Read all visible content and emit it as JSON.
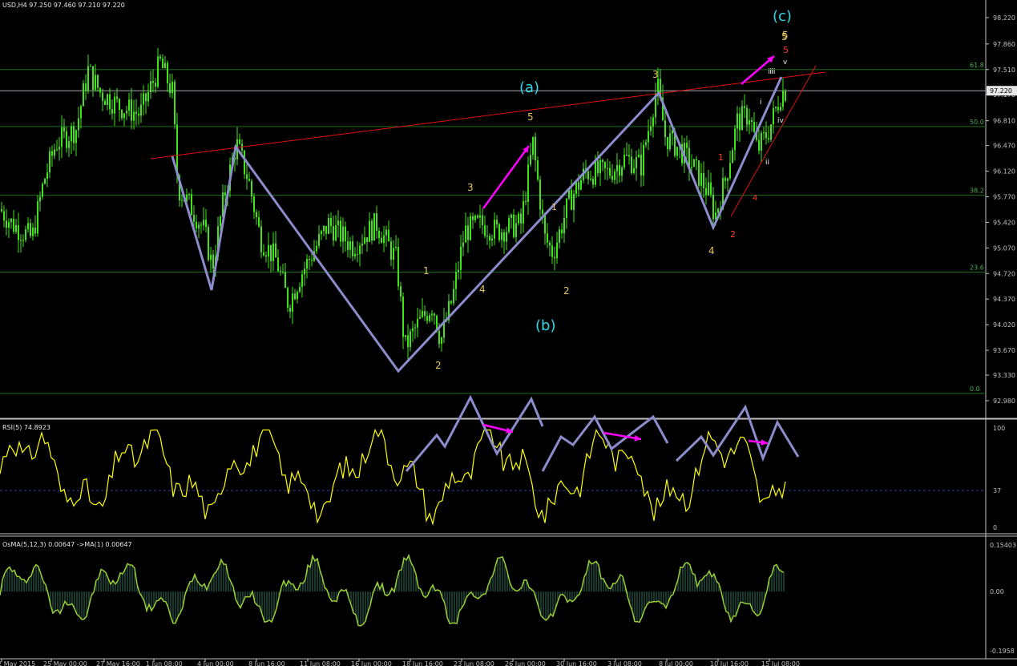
{
  "symbol_line": "USD,H4  97.250 97.460 97.210 97.220",
  "rsi_label": "RSI(5) 74.8923",
  "osma_label": "OsMA(5,12,3) 0.00647   ->MA(1) 0.00647",
  "price_tag": "97.220",
  "chart_data": {
    "type": "candlestick",
    "price_axis": {
      "ticks": [
        "98.220",
        "97.860",
        "97.510",
        "97.170",
        "96.810",
        "96.470",
        "96.120",
        "95.770",
        "95.420",
        "95.070",
        "94.720",
        "94.370",
        "94.020",
        "93.670",
        "93.330",
        "92.980"
      ],
      "ylim": [
        92.98,
        98.22
      ]
    },
    "time_axis": {
      "ticks": [
        "22 May 2015",
        "25 May 00:00",
        "27 May 16:00",
        "1 Jun 08:00",
        "4 Jun 00:00",
        "8 Jun 16:00",
        "11 Jun 08:00",
        "16 Jun 00:00",
        "18 Jun 16:00",
        "23 Jun 08:00",
        "26 Jun 00:00",
        "30 Jun 16:00",
        "3 Jul 08:00",
        "8 Jul 00:00",
        "10 Jul 16:00",
        "15 Jul 08:00"
      ]
    },
    "fibonacci_levels": [
      {
        "label": "61.8",
        "price": 97.51
      },
      {
        "label": "50.0",
        "price": 96.73
      },
      {
        "label": "38.2",
        "price": 95.79
      },
      {
        "label": "23.6",
        "price": 94.74
      },
      {
        "label": "0.0",
        "price": 93.08
      }
    ],
    "current_price": 97.22,
    "wave_labels": [
      {
        "text": "(a)",
        "color": "#33d6e6"
      },
      {
        "text": "(b)",
        "color": "#33d6e6"
      },
      {
        "text": "(c)",
        "color": "#33d6e6"
      },
      {
        "text": "1",
        "color": "#e6c65a"
      },
      {
        "text": "2",
        "color": "#e6c65a"
      },
      {
        "text": "3",
        "color": "#e6c65a"
      },
      {
        "text": "4",
        "color": "#e6c65a"
      },
      {
        "text": "5",
        "color": "#e6c65a"
      },
      {
        "text": "1",
        "color": "#e6c65a"
      },
      {
        "text": "2",
        "color": "#e6c65a"
      },
      {
        "text": "3",
        "color": "#e6c65a"
      },
      {
        "text": "4",
        "color": "#e6c65a"
      },
      {
        "text": "5",
        "color": "#e6c65a"
      },
      {
        "text": "1",
        "color": "#e6c65a"
      },
      {
        "text": "2",
        "color": "#e6c65a"
      },
      {
        "text": "3",
        "color": "#e6c65a"
      },
      {
        "text": "4",
        "color": "#e6c65a"
      },
      {
        "text": "5",
        "color": "#e6c65a"
      },
      {
        "text": "1",
        "color": "#ff3b2f"
      },
      {
        "text": "2",
        "color": "#ff3b2f"
      },
      {
        "text": "4",
        "color": "#ff3b2f"
      },
      {
        "text": "5",
        "color": "#ff3b2f"
      },
      {
        "text": "i",
        "color": "#c8c8c8"
      },
      {
        "text": "ii",
        "color": "#c8c8c8"
      },
      {
        "text": "iii",
        "color": "#c8c8c8"
      },
      {
        "text": "iv",
        "color": "#c8c8c8"
      },
      {
        "text": "v",
        "color": "#c8c8c8"
      }
    ],
    "rsi": {
      "ticks": [
        "100",
        "37",
        "0"
      ],
      "level": 37
    },
    "osma": {
      "ticks": [
        "0.15403",
        "0.00",
        "-0.1958"
      ]
    },
    "colors": {
      "candle": "#3fe41a",
      "wave_line": "#8c8ccc",
      "trend_line": "#e01010",
      "arrow": "#ff00ff",
      "rsi_line": "#ffff00",
      "osma_line": "#9acd32",
      "fib_line": "#1e6e1e",
      "background": "#000000",
      "axis_text": "#c0c0c0"
    }
  }
}
